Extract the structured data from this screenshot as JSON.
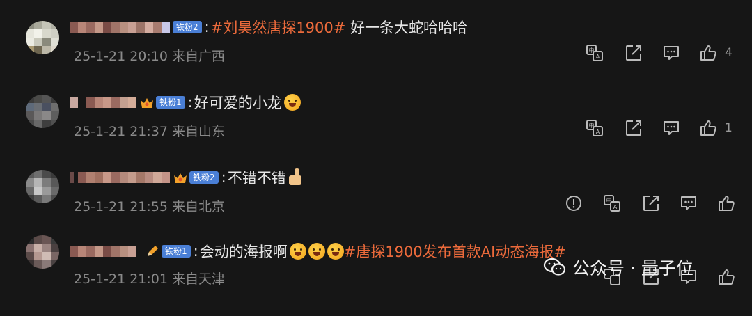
{
  "comments": [
    {
      "badge": "铁粉2",
      "colon": ":",
      "topic": "#刘昊然唐探1900#",
      "text": " 好一条大蛇哈哈哈",
      "date": "25-1-21 20:10",
      "location": "来自广西",
      "likes": "4"
    },
    {
      "badge": "铁粉1",
      "colon": ":",
      "text": "好可爱的小龙",
      "date": "25-1-21 21:37",
      "location": "来自山东",
      "likes": "1"
    },
    {
      "badge": "铁粉2",
      "colon": ":",
      "text": "不错不错",
      "date": "25-1-21 21:55",
      "location": "来自北京",
      "likes": ""
    },
    {
      "badge": "铁粉1",
      "colon": ":",
      "text": "会动的海报啊",
      "topic": "#唐探1900发布首款AI动态海报#",
      "date": "25-1-21 21:01",
      "location": "来自天津",
      "likes": ""
    }
  ],
  "watermark": {
    "text": "公众号 · 量子位"
  },
  "icons": {
    "translate": "translate-icon",
    "share": "share-icon",
    "reply": "comment-icon",
    "like": "thumbs-up-icon",
    "report": "alert-icon"
  },
  "colors": {
    "background": "#161616",
    "topic": "#eb6a3b",
    "badge": "#4a7fd6",
    "meta": "#8a8a8a"
  }
}
